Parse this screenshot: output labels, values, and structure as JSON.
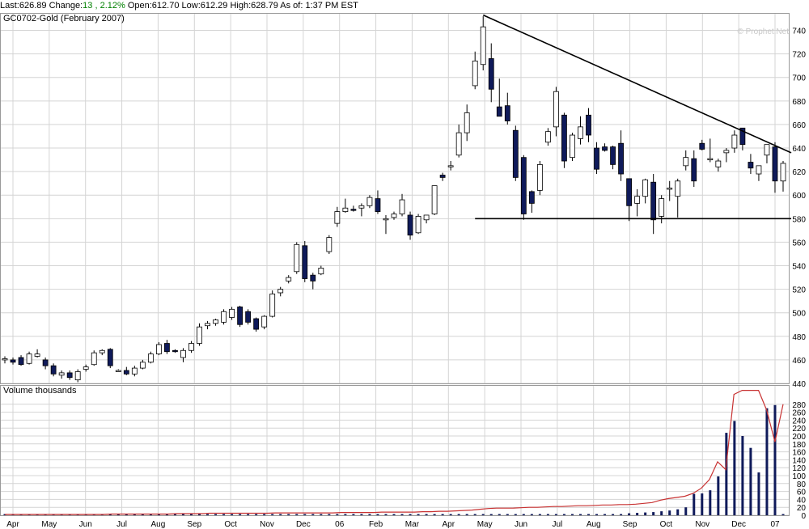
{
  "quote": {
    "last_label": "Last:",
    "last": "626.89",
    "change_label": "Change:",
    "change": "13 , 2.12%",
    "open_label": "Open:",
    "open": "612.70",
    "low_label": "Low:",
    "low": "612.29",
    "high_label": "High:",
    "high": "628.79",
    "asof": "As of: 1:37 PM EST"
  },
  "colors": {
    "up": "#ffffff",
    "down": "#0f1a5a",
    "candle_border": "#000000",
    "grid": "#d4d4d4",
    "volume_line": "#c83232",
    "trend_line": "#000000",
    "positive": "#008000"
  },
  "chart_data": {
    "type": "candlestick",
    "title": "GC0702-Gold (February 2007)",
    "watermark": "© Prophet.Net",
    "price_axis": {
      "min": 440,
      "max": 750,
      "ticks": [
        440,
        460,
        480,
        500,
        520,
        540,
        560,
        580,
        600,
        620,
        640,
        660,
        680,
        700,
        720,
        740
      ]
    },
    "volume_axis": {
      "label": "Volume  thousands",
      "min": 0,
      "max": 300,
      "ticks": [
        0,
        20,
        40,
        60,
        80,
        100,
        120,
        140,
        160,
        180,
        200,
        220,
        240,
        260,
        280
      ]
    },
    "x_labels": [
      "Apr",
      "May",
      "Jun",
      "Jul",
      "Aug",
      "Sep",
      "Oct",
      "Nov",
      "Dec",
      "06",
      "Feb",
      "Mar",
      "Apr",
      "May",
      "Jun",
      "Jul",
      "Aug",
      "Sep",
      "Oct",
      "Nov",
      "Dec",
      "07"
    ],
    "candles": [
      {
        "o": 460,
        "h": 463,
        "l": 457,
        "c": 461
      },
      {
        "o": 460,
        "h": 462,
        "l": 456,
        "c": 458
      },
      {
        "o": 462,
        "h": 464,
        "l": 455,
        "c": 456
      },
      {
        "o": 457,
        "h": 467,
        "l": 456,
        "c": 465
      },
      {
        "o": 463,
        "h": 469,
        "l": 462,
        "c": 465
      },
      {
        "o": 460,
        "h": 462,
        "l": 452,
        "c": 455
      },
      {
        "o": 455,
        "h": 457,
        "l": 446,
        "c": 448
      },
      {
        "o": 447,
        "h": 451,
        "l": 444,
        "c": 449
      },
      {
        "o": 449,
        "h": 451,
        "l": 443,
        "c": 445
      },
      {
        "o": 443,
        "h": 452,
        "l": 441,
        "c": 450
      },
      {
        "o": 452,
        "h": 456,
        "l": 450,
        "c": 454
      },
      {
        "o": 456,
        "h": 468,
        "l": 455,
        "c": 466
      },
      {
        "o": 466,
        "h": 469,
        "l": 464,
        "c": 468
      },
      {
        "o": 469,
        "h": 470,
        "l": 453,
        "c": 455
      },
      {
        "o": 451,
        "h": 452,
        "l": 450,
        "c": 451
      },
      {
        "o": 451,
        "h": 454,
        "l": 447,
        "c": 448
      },
      {
        "o": 448,
        "h": 455,
        "l": 446,
        "c": 453
      },
      {
        "o": 453,
        "h": 460,
        "l": 452,
        "c": 458
      },
      {
        "o": 458,
        "h": 467,
        "l": 457,
        "c": 465
      },
      {
        "o": 465,
        "h": 475,
        "l": 464,
        "c": 473
      },
      {
        "o": 474,
        "h": 477,
        "l": 465,
        "c": 467
      },
      {
        "o": 468,
        "h": 469,
        "l": 466,
        "c": 467
      },
      {
        "o": 462,
        "h": 470,
        "l": 458,
        "c": 468
      },
      {
        "o": 468,
        "h": 476,
        "l": 466,
        "c": 474
      },
      {
        "o": 474,
        "h": 491,
        "l": 472,
        "c": 488
      },
      {
        "o": 489,
        "h": 493,
        "l": 486,
        "c": 491
      },
      {
        "o": 491,
        "h": 495,
        "l": 489,
        "c": 494
      },
      {
        "o": 492,
        "h": 503,
        "l": 490,
        "c": 501
      },
      {
        "o": 496,
        "h": 505,
        "l": 494,
        "c": 503
      },
      {
        "o": 505,
        "h": 506,
        "l": 488,
        "c": 490
      },
      {
        "o": 501,
        "h": 503,
        "l": 490,
        "c": 492
      },
      {
        "o": 495,
        "h": 496,
        "l": 484,
        "c": 486
      },
      {
        "o": 488,
        "h": 498,
        "l": 486,
        "c": 497
      },
      {
        "o": 497,
        "h": 519,
        "l": 496,
        "c": 516
      },
      {
        "o": 517,
        "h": 522,
        "l": 514,
        "c": 520
      },
      {
        "o": 527,
        "h": 532,
        "l": 525,
        "c": 530
      },
      {
        "o": 535,
        "h": 560,
        "l": 533,
        "c": 558
      },
      {
        "o": 557,
        "h": 561,
        "l": 526,
        "c": 529
      },
      {
        "o": 532,
        "h": 534,
        "l": 520,
        "c": 527
      },
      {
        "o": 533,
        "h": 540,
        "l": 532,
        "c": 538
      },
      {
        "o": 552,
        "h": 566,
        "l": 550,
        "c": 564
      },
      {
        "o": 576,
        "h": 590,
        "l": 573,
        "c": 586
      },
      {
        "o": 586,
        "h": 597,
        "l": 585,
        "c": 589
      },
      {
        "o": 588,
        "h": 591,
        "l": 586,
        "c": 587
      },
      {
        "o": 589,
        "h": 593,
        "l": 582,
        "c": 591
      },
      {
        "o": 591,
        "h": 600,
        "l": 589,
        "c": 598
      },
      {
        "o": 597,
        "h": 604,
        "l": 584,
        "c": 586
      },
      {
        "o": 579,
        "h": 583,
        "l": 567,
        "c": 580
      },
      {
        "o": 581,
        "h": 586,
        "l": 579,
        "c": 584
      },
      {
        "o": 584,
        "h": 601,
        "l": 582,
        "c": 596
      },
      {
        "o": 583,
        "h": 586,
        "l": 562,
        "c": 566
      },
      {
        "o": 568,
        "h": 584,
        "l": 567,
        "c": 582
      },
      {
        "o": 579,
        "h": 582,
        "l": 576,
        "c": 583
      },
      {
        "o": 584,
        "h": 602,
        "l": 583,
        "c": 608
      },
      {
        "o": 617,
        "h": 619,
        "l": 612,
        "c": 615
      },
      {
        "o": 624,
        "h": 629,
        "l": 621,
        "c": 625
      },
      {
        "o": 634,
        "h": 660,
        "l": 632,
        "c": 653
      },
      {
        "o": 653,
        "h": 677,
        "l": 646,
        "c": 670
      },
      {
        "o": 693,
        "h": 722,
        "l": 690,
        "c": 714
      },
      {
        "o": 711,
        "h": 752,
        "l": 706,
        "c": 743
      },
      {
        "o": 716,
        "h": 729,
        "l": 679,
        "c": 690
      },
      {
        "o": 675,
        "h": 699,
        "l": 669,
        "c": 667
      },
      {
        "o": 676,
        "h": 687,
        "l": 660,
        "c": 663
      },
      {
        "o": 655,
        "h": 659,
        "l": 612,
        "c": 615
      },
      {
        "o": 632,
        "h": 634,
        "l": 579,
        "c": 584
      },
      {
        "o": 603,
        "h": 604,
        "l": 585,
        "c": 593
      },
      {
        "o": 604,
        "h": 629,
        "l": 600,
        "c": 626
      },
      {
        "o": 645,
        "h": 657,
        "l": 642,
        "c": 654
      },
      {
        "o": 658,
        "h": 692,
        "l": 650,
        "c": 688
      },
      {
        "o": 668,
        "h": 670,
        "l": 623,
        "c": 629
      },
      {
        "o": 632,
        "h": 653,
        "l": 629,
        "c": 651
      },
      {
        "o": 648,
        "h": 667,
        "l": 643,
        "c": 658
      },
      {
        "o": 668,
        "h": 674,
        "l": 645,
        "c": 651
      },
      {
        "o": 640,
        "h": 645,
        "l": 618,
        "c": 622
      },
      {
        "o": 641,
        "h": 644,
        "l": 637,
        "c": 638
      },
      {
        "o": 641,
        "h": 642,
        "l": 622,
        "c": 626
      },
      {
        "o": 644,
        "h": 655,
        "l": 612,
        "c": 618
      },
      {
        "o": 614,
        "h": 612,
        "l": 578,
        "c": 591
      },
      {
        "o": 593,
        "h": 605,
        "l": 582,
        "c": 599
      },
      {
        "o": 599,
        "h": 614,
        "l": 593,
        "c": 613
      },
      {
        "o": 611,
        "h": 618,
        "l": 567,
        "c": 579
      },
      {
        "o": 582,
        "h": 600,
        "l": 576,
        "c": 597
      },
      {
        "o": 605,
        "h": 612,
        "l": 595,
        "c": 606
      },
      {
        "o": 599,
        "h": 614,
        "l": 581,
        "c": 612
      },
      {
        "o": 625,
        "h": 638,
        "l": 621,
        "c": 632
      },
      {
        "o": 631,
        "h": 638,
        "l": 607,
        "c": 612
      },
      {
        "o": 644,
        "h": 647,
        "l": 638,
        "c": 639
      },
      {
        "o": 630,
        "h": 648,
        "l": 628,
        "c": 631
      },
      {
        "o": 624,
        "h": 631,
        "l": 620,
        "c": 629
      },
      {
        "o": 636,
        "h": 640,
        "l": 628,
        "c": 638
      },
      {
        "o": 640,
        "h": 655,
        "l": 636,
        "c": 651
      },
      {
        "o": 657,
        "h": 657,
        "l": 638,
        "c": 643
      },
      {
        "o": 628,
        "h": 635,
        "l": 618,
        "c": 623
      },
      {
        "o": 618,
        "h": 622,
        "l": 612,
        "c": 625
      },
      {
        "o": 634,
        "h": 640,
        "l": 627,
        "c": 643
      },
      {
        "o": 641,
        "h": 645,
        "l": 602,
        "c": 612
      },
      {
        "o": 612,
        "h": 629,
        "l": 603,
        "c": 627
      }
    ],
    "volume": [
      3,
      3,
      3,
      3,
      3,
      3,
      3,
      3,
      3,
      3,
      3,
      3,
      3,
      3,
      3,
      3,
      3,
      3,
      3,
      3,
      3,
      3,
      3,
      3,
      3,
      3,
      3,
      3,
      3,
      3,
      3,
      3,
      3,
      3,
      3,
      3,
      3,
      3,
      3,
      3,
      3,
      3,
      3,
      3,
      3,
      3,
      3,
      3,
      3,
      3,
      3,
      3,
      3,
      3,
      3,
      3,
      3,
      3,
      3,
      3,
      3,
      3,
      3,
      3,
      3,
      3,
      3,
      3,
      3,
      3,
      3,
      3,
      3,
      3,
      3,
      3,
      3,
      3,
      3,
      3,
      3,
      3,
      3,
      3,
      3,
      3,
      3,
      3,
      3,
      3,
      3,
      3,
      3,
      3,
      3,
      3,
      3
    ],
    "volume_bars_late": [
      {
        "i": 77,
        "v": 5
      },
      {
        "i": 78,
        "v": 6
      },
      {
        "i": 79,
        "v": 7
      },
      {
        "i": 80,
        "v": 8
      },
      {
        "i": 81,
        "v": 10
      },
      {
        "i": 82,
        "v": 12
      },
      {
        "i": 83,
        "v": 15
      },
      {
        "i": 84,
        "v": 20
      },
      {
        "i": 85,
        "v": 54
      },
      {
        "i": 86,
        "v": 55
      },
      {
        "i": 87,
        "v": 63
      },
      {
        "i": 88,
        "v": 98
      },
      {
        "i": 89,
        "v": 208
      },
      {
        "i": 90,
        "v": 238
      },
      {
        "i": 91,
        "v": 200
      },
      {
        "i": 92,
        "v": 170
      },
      {
        "i": 93,
        "v": 108
      },
      {
        "i": 94,
        "v": 270
      },
      {
        "i": 95,
        "v": 278
      }
    ],
    "open_interest_line": [
      2,
      2,
      2,
      2,
      2,
      2,
      2,
      2,
      2,
      2,
      2,
      2,
      2,
      3,
      3,
      3,
      3,
      3,
      3,
      3,
      3,
      4,
      4,
      4,
      4,
      5,
      5,
      5,
      5,
      5,
      5,
      5,
      5,
      6,
      6,
      6,
      6,
      6,
      6,
      6,
      6,
      7,
      7,
      7,
      7,
      7,
      8,
      8,
      8,
      8,
      8,
      9,
      9,
      10,
      10,
      11,
      12,
      13,
      15,
      17,
      18,
      18,
      18,
      19,
      20,
      20,
      21,
      22,
      22,
      23,
      24,
      24,
      25,
      26,
      26,
      27,
      27,
      28,
      30,
      32,
      38,
      42,
      45,
      48,
      55,
      68,
      90,
      135,
      115,
      305,
      315,
      315,
      315,
      265,
      185,
      280
    ],
    "trend_lines": [
      {
        "name": "resistance",
        "from": {
          "i": 59,
          "p": 753
        },
        "to": {
          "i": 97,
          "p": 636
        }
      },
      {
        "name": "support",
        "from": {
          "i": 58,
          "p": 580
        },
        "to": {
          "i": 97,
          "p": 580
        }
      }
    ]
  }
}
